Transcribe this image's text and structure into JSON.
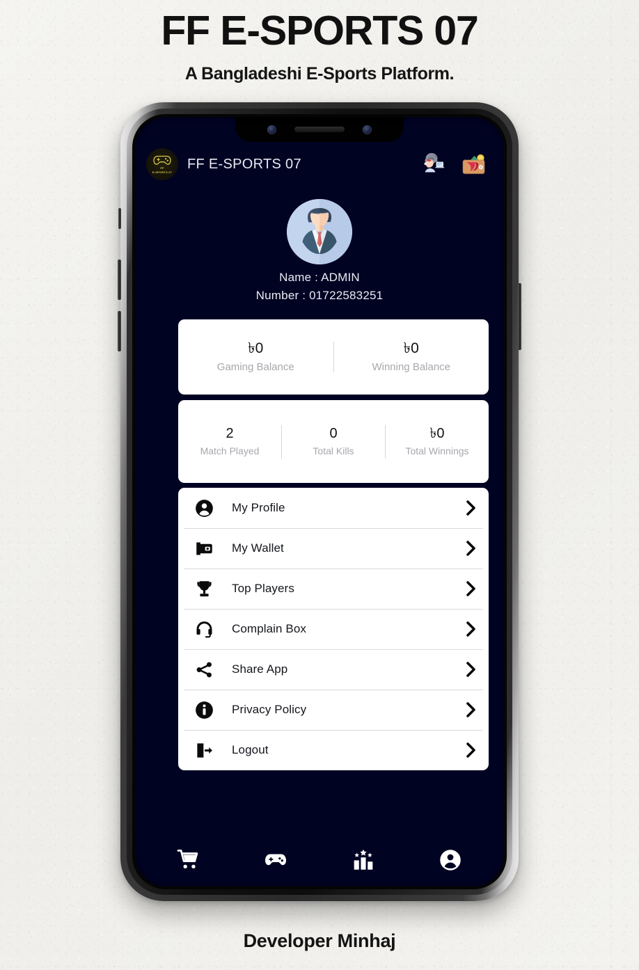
{
  "poster": {
    "title": "FF E-SPORTS 07",
    "subtitle": "A Bangladeshi E-Sports Platform.",
    "footer": "Developer Minhaj"
  },
  "colors": {
    "screen_bg": "#000322",
    "card_bg": "#ffffff",
    "label_gray": "#a7a7ad",
    "text_dark": "#14161c",
    "screen_text": "#e7e9f3",
    "logo_gold": "#d8c84a"
  },
  "appbar": {
    "logo_name": "gamepad-logo-icon",
    "logo_caption": "E-SPORTS 07",
    "logo_mark": "FF",
    "title": "FF E-SPORTS 07",
    "actions": [
      {
        "name": "support-agent-icon",
        "label": "Support"
      },
      {
        "name": "wallet-icon",
        "label": "Wallet"
      }
    ]
  },
  "profile": {
    "avatar_name": "user-avatar",
    "name_line": "Name : ADMIN",
    "number_line": "Number : 01722583251"
  },
  "balance_card": {
    "cells": [
      {
        "value": "৳0",
        "label": "Gaming Balance"
      },
      {
        "value": "৳0",
        "label": "Winning Balance"
      }
    ]
  },
  "stats_card": {
    "cells": [
      {
        "value": "2",
        "label": "Match Played"
      },
      {
        "value": "0",
        "label": "Total Kills"
      },
      {
        "value": "৳0",
        "label": "Total Winnings"
      }
    ]
  },
  "menu": {
    "items": [
      {
        "label": "My Profile",
        "icon": "person-circle-icon"
      },
      {
        "label": "My Wallet",
        "icon": "wallet-icon"
      },
      {
        "label": "Top Players",
        "icon": "trophy-icon"
      },
      {
        "label": "Complain Box",
        "icon": "headset-icon"
      },
      {
        "label": "Share App",
        "icon": "share-icon"
      },
      {
        "label": "Privacy Policy",
        "icon": "info-circle-icon"
      },
      {
        "label": "Logout",
        "icon": "logout-icon"
      }
    ]
  },
  "bottom_nav": {
    "items": [
      {
        "name": "shop-cart-icon",
        "label": "Shop"
      },
      {
        "name": "gamepad-icon",
        "label": "Play"
      },
      {
        "name": "leaderboard-icon",
        "label": "Ranking"
      },
      {
        "name": "account-icon",
        "label": "Account"
      }
    ]
  }
}
